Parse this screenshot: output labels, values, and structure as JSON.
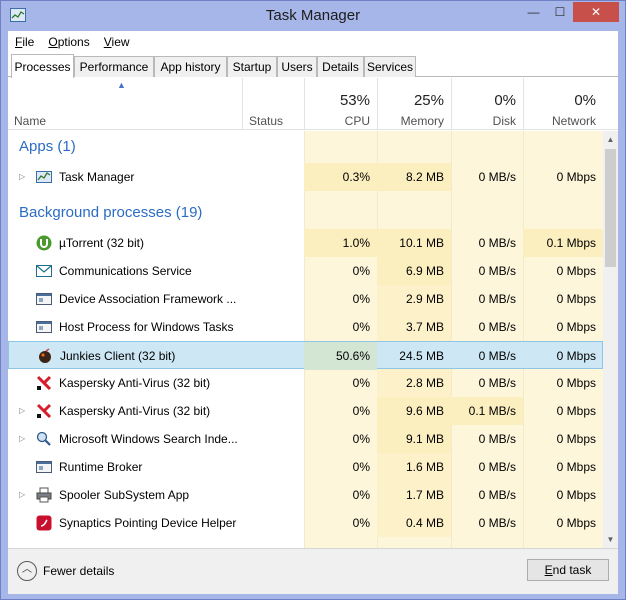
{
  "window": {
    "title": "Task Manager",
    "minimize_glyph": "—",
    "maximize_glyph": "☐",
    "close_glyph": "✕"
  },
  "menu": [
    {
      "label": "File",
      "mnemonic": "F"
    },
    {
      "label": "Options",
      "mnemonic": "O"
    },
    {
      "label": "View",
      "mnemonic": "V"
    }
  ],
  "tabs": [
    {
      "label": "Processes",
      "active": true
    },
    {
      "label": "Performance"
    },
    {
      "label": "App history"
    },
    {
      "label": "Startup"
    },
    {
      "label": "Users"
    },
    {
      "label": "Details"
    },
    {
      "label": "Services"
    }
  ],
  "columns": {
    "name": "Name",
    "status": "Status",
    "cpu": {
      "percent": "53%",
      "label": "CPU"
    },
    "memory": {
      "percent": "25%",
      "label": "Memory"
    },
    "disk": {
      "percent": "0%",
      "label": "Disk"
    },
    "network": {
      "percent": "0%",
      "label": "Network"
    }
  },
  "groups": {
    "apps": "Apps (1)",
    "background": "Background processes (19)"
  },
  "apps": [
    {
      "name": "Task Manager",
      "icon": "task-manager-icon",
      "expandable": true,
      "cpu": "0.3%",
      "memory": "8.2 MB",
      "disk": "0 MB/s",
      "network": "0 Mbps"
    }
  ],
  "background": [
    {
      "name": "µTorrent (32 bit)",
      "icon": "utorrent-icon",
      "expandable": false,
      "cpu": "1.0%",
      "memory": "10.1 MB",
      "disk": "0 MB/s",
      "network": "0.1 Mbps"
    },
    {
      "name": "Communications Service",
      "icon": "mail-icon",
      "expandable": false,
      "cpu": "0%",
      "memory": "6.9 MB",
      "disk": "0 MB/s",
      "network": "0 Mbps"
    },
    {
      "name": "Device Association Framework ...",
      "icon": "service-window-icon",
      "expandable": false,
      "cpu": "0%",
      "memory": "2.9 MB",
      "disk": "0 MB/s",
      "network": "0 Mbps"
    },
    {
      "name": "Host Process for Windows Tasks",
      "icon": "service-window-icon",
      "expandable": false,
      "cpu": "0%",
      "memory": "3.7 MB",
      "disk": "0 MB/s",
      "network": "0 Mbps"
    },
    {
      "name": "Junkies Client (32 bit)",
      "icon": "junkies-client-icon",
      "expandable": false,
      "selected": true,
      "cpu": "50.6%",
      "memory": "24.5 MB",
      "disk": "0 MB/s",
      "network": "0 Mbps"
    },
    {
      "name": "Kaspersky Anti-Virus (32 bit)",
      "icon": "kaspersky-icon",
      "expandable": false,
      "cpu": "0%",
      "memory": "2.8 MB",
      "disk": "0 MB/s",
      "network": "0 Mbps"
    },
    {
      "name": "Kaspersky Anti-Virus (32 bit)",
      "icon": "kaspersky-icon",
      "expandable": true,
      "cpu": "0%",
      "memory": "9.6 MB",
      "disk": "0.1 MB/s",
      "network": "0 Mbps"
    },
    {
      "name": "Microsoft Windows Search Inde...",
      "icon": "search-indexer-icon",
      "expandable": true,
      "cpu": "0%",
      "memory": "9.1 MB",
      "disk": "0 MB/s",
      "network": "0 Mbps"
    },
    {
      "name": "Runtime Broker",
      "icon": "service-window-icon",
      "expandable": false,
      "cpu": "0%",
      "memory": "1.6 MB",
      "disk": "0 MB/s",
      "network": "0 Mbps"
    },
    {
      "name": "Spooler SubSystem App",
      "icon": "printer-icon",
      "expandable": true,
      "cpu": "0%",
      "memory": "1.7 MB",
      "disk": "0 MB/s",
      "network": "0 Mbps"
    },
    {
      "name": "Synaptics Pointing Device Helper",
      "icon": "synaptics-icon",
      "expandable": false,
      "cpu": "0%",
      "memory": "0.4 MB",
      "disk": "0 MB/s",
      "network": "0 Mbps"
    }
  ],
  "footer": {
    "fewer_details": "Fewer details",
    "end_task": "End task",
    "end_task_mnemonic": "E"
  },
  "colors": {
    "accent": "#2b6cc4",
    "selection": "#cde8f4",
    "heat": "#fbe9a9",
    "heat_bg": "#fdf6da",
    "frame": "#a7b6e8"
  }
}
